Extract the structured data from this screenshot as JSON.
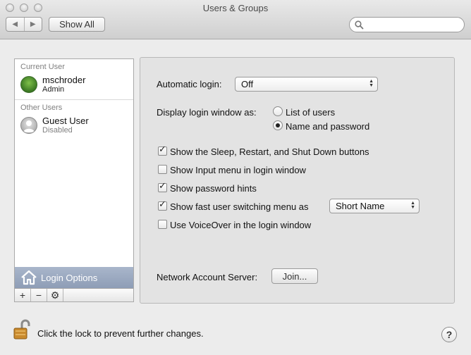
{
  "window": {
    "title": "Users & Groups"
  },
  "toolbar": {
    "back_glyph": "◀",
    "forward_glyph": "▶",
    "show_all_label": "Show All",
    "search_placeholder": ""
  },
  "sidebar": {
    "current_user_header": "Current User",
    "current_user": {
      "name": "mschroder",
      "role": "Admin",
      "avatar_icon": "leaf-avatar-icon"
    },
    "other_users_header": "Other Users",
    "other_users": [
      {
        "name": "Guest User",
        "role": "Disabled",
        "avatar_icon": "guest-avatar-icon"
      }
    ],
    "login_options_label": "Login Options",
    "add_glyph": "+",
    "remove_glyph": "−",
    "action_glyph": "⚙"
  },
  "panel": {
    "automatic_login_label": "Automatic login:",
    "automatic_login_value": "Off",
    "display_login_label": "Display login window as:",
    "radio_options": [
      {
        "label": "List of users",
        "selected": false
      },
      {
        "label": "Name and password",
        "selected": true
      }
    ],
    "checkboxes": [
      {
        "label": "Show the Sleep, Restart, and Shut Down buttons",
        "checked": true
      },
      {
        "label": "Show Input menu in login window",
        "checked": false
      },
      {
        "label": "Show password hints",
        "checked": true
      },
      {
        "label": "Show fast user switching menu as",
        "checked": true
      },
      {
        "label": "Use VoiceOver in the login window",
        "checked": false
      }
    ],
    "fast_switch_value": "Short Name",
    "network_account_label": "Network Account Server:",
    "join_button_label": "Join..."
  },
  "footer": {
    "lock_text": "Click the lock to prevent further changes.",
    "help_glyph": "?"
  },
  "colors": {
    "selection": "#9aa8c0",
    "window_bg": "#ececec",
    "panel_bg": "#e3e3e3"
  }
}
